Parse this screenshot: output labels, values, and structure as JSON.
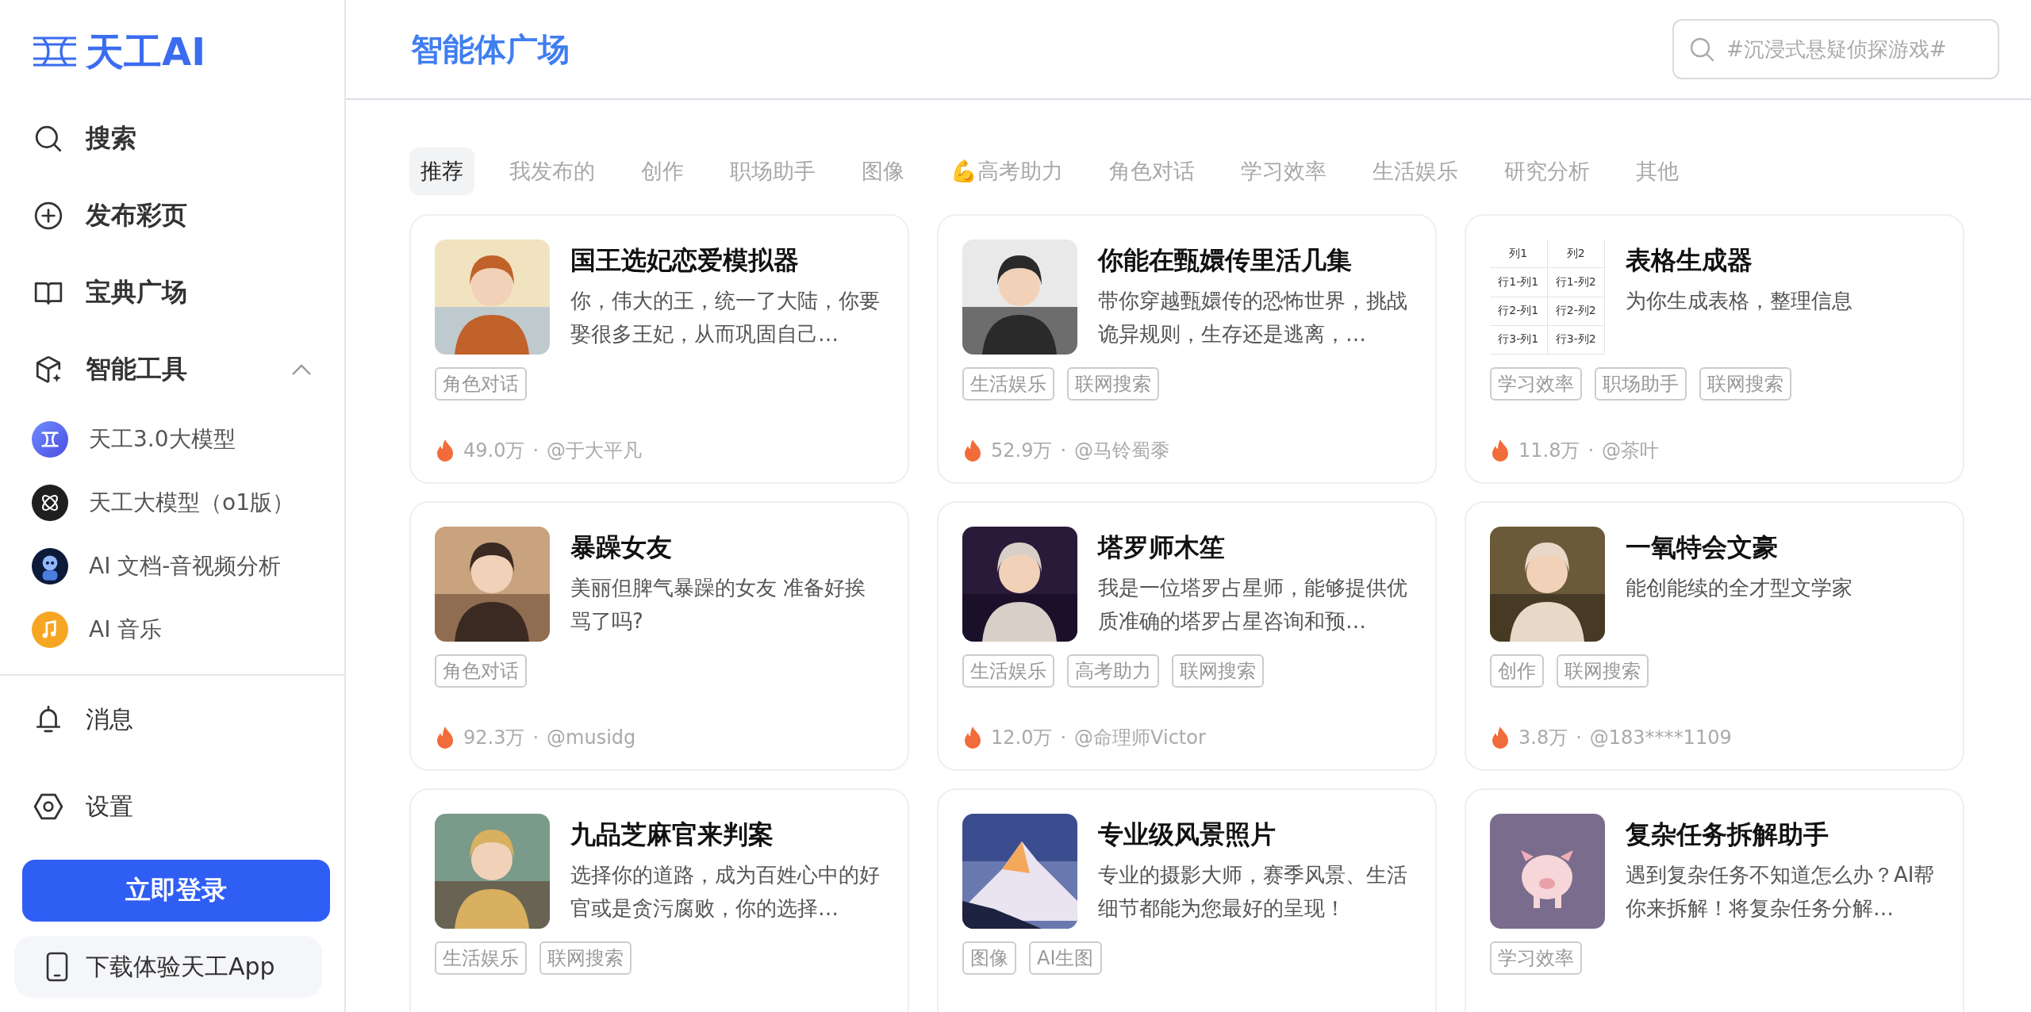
{
  "sidebar": {
    "logo": "天工AI",
    "nav": [
      {
        "kind": "search",
        "label": "搜索"
      },
      {
        "kind": "plus",
        "label": "发布彩页"
      },
      {
        "kind": "book",
        "label": "宝典广场"
      },
      {
        "kind": "cube",
        "label": "智能工具",
        "expanded": true
      }
    ],
    "tools": [
      {
        "kind": "tiangong",
        "label": "天工3.0大模型"
      },
      {
        "kind": "atom",
        "label": "天工大模型（o1版）"
      },
      {
        "kind": "robot",
        "label": "AI 文档-音视频分析"
      },
      {
        "kind": "music",
        "label": "AI 音乐"
      }
    ],
    "bottom": [
      {
        "kind": "bell",
        "label": "消息"
      },
      {
        "kind": "hexagon",
        "label": "设置"
      }
    ],
    "login_button": "立即登录",
    "download": "下载体验天工App"
  },
  "header": {
    "title": "智能体广场",
    "search": {
      "placeholder": "#沉浸式悬疑侦探游戏#"
    }
  },
  "tabs": [
    {
      "label": "推荐",
      "selected": true
    },
    {
      "label": "我发布的",
      "selected": false
    },
    {
      "label": "创作",
      "selected": false
    },
    {
      "label": "职场助手",
      "selected": false
    },
    {
      "label": "图像",
      "selected": false
    },
    {
      "label": "💪高考助力",
      "selected": false
    },
    {
      "label": "角色对话",
      "selected": false
    },
    {
      "label": "学习效率",
      "selected": false
    },
    {
      "label": "生活娱乐",
      "selected": false
    },
    {
      "label": "研究分析",
      "selected": false
    },
    {
      "label": "其他",
      "selected": false
    }
  ],
  "cards": [
    {
      "title": "国王选妃恋爱模拟器",
      "description": "你，伟大的王，统一了大陆，你要娶很多王妃，从而巩固自己…",
      "tags": [
        "角色对话"
      ],
      "count": "49.0万",
      "separator": "·",
      "author": "@于大平凡",
      "thumbnail": {
        "kind": "picture"
      }
    },
    {
      "title": "你能在甄嬛传里活几集",
      "description": "带你穿越甄嬛传的恐怖世界，挑战诡异规则，生存还是逃离，…",
      "tags": [
        "生活娱乐",
        "联网搜索"
      ],
      "count": "52.9万",
      "separator": "·",
      "author": "@马铃蜀黍",
      "thumbnail": {
        "kind": "picture"
      }
    },
    {
      "title": "表格生成器",
      "description": "为你生成表格，整理信息",
      "tags": [
        "学习效率",
        "职场助手",
        "联网搜索"
      ],
      "count": "11.8万",
      "separator": "·",
      "author": "@茶叶",
      "thumbnail": {
        "kind": "table",
        "rows": [
          [
            "列1",
            "列2"
          ],
          [
            "行1-列1",
            "行1-列2"
          ],
          [
            "行2-列1",
            "行2-列2"
          ],
          [
            "行3-列1",
            "行3-列2"
          ]
        ]
      }
    },
    {
      "title": "暴躁女友",
      "description": "美丽但脾气暴躁的女友 准备好挨骂了吗?",
      "tags": [
        "角色对话"
      ],
      "count": "92.3万",
      "separator": "·",
      "author": "@musidg",
      "thumbnail": {
        "kind": "picture"
      }
    },
    {
      "title": "塔罗师木笙",
      "description": "我是一位塔罗占星师，能够提供优质准确的塔罗占星咨询和预…",
      "tags": [
        "生活娱乐",
        "高考助力",
        "联网搜索"
      ],
      "count": "12.0万",
      "separator": "·",
      "author": "@命理师Victor",
      "thumbnail": {
        "kind": "picture"
      }
    },
    {
      "title": "一氧特会文豪",
      "description": "能创能续的全才型文学家",
      "tags": [
        "创作",
        "联网搜索"
      ],
      "count": "3.8万",
      "separator": "·",
      "author": "@183****1109",
      "thumbnail": {
        "kind": "picture"
      }
    },
    {
      "title": "九品芝麻官来判案",
      "description": "选择你的道路，成为百姓心中的好官或是贪污腐败，你的选择…",
      "tags": [
        "生活娱乐",
        "联网搜索"
      ],
      "thumbnail": {
        "kind": "picture"
      }
    },
    {
      "title": "专业级风景照片",
      "description": "专业的摄影大师，赛季风景、生活细节都能为您最好的呈现！",
      "tags": [
        "图像",
        "AI生图"
      ],
      "thumbnail": {
        "kind": "picture"
      }
    },
    {
      "title": "复杂任务拆解助手",
      "description": "遇到复杂任务不知道怎么办？AI帮你来拆解！将复杂任务分解…",
      "tags": [
        "学习效率"
      ],
      "thumbnail": {
        "kind": "picture"
      }
    }
  ]
}
